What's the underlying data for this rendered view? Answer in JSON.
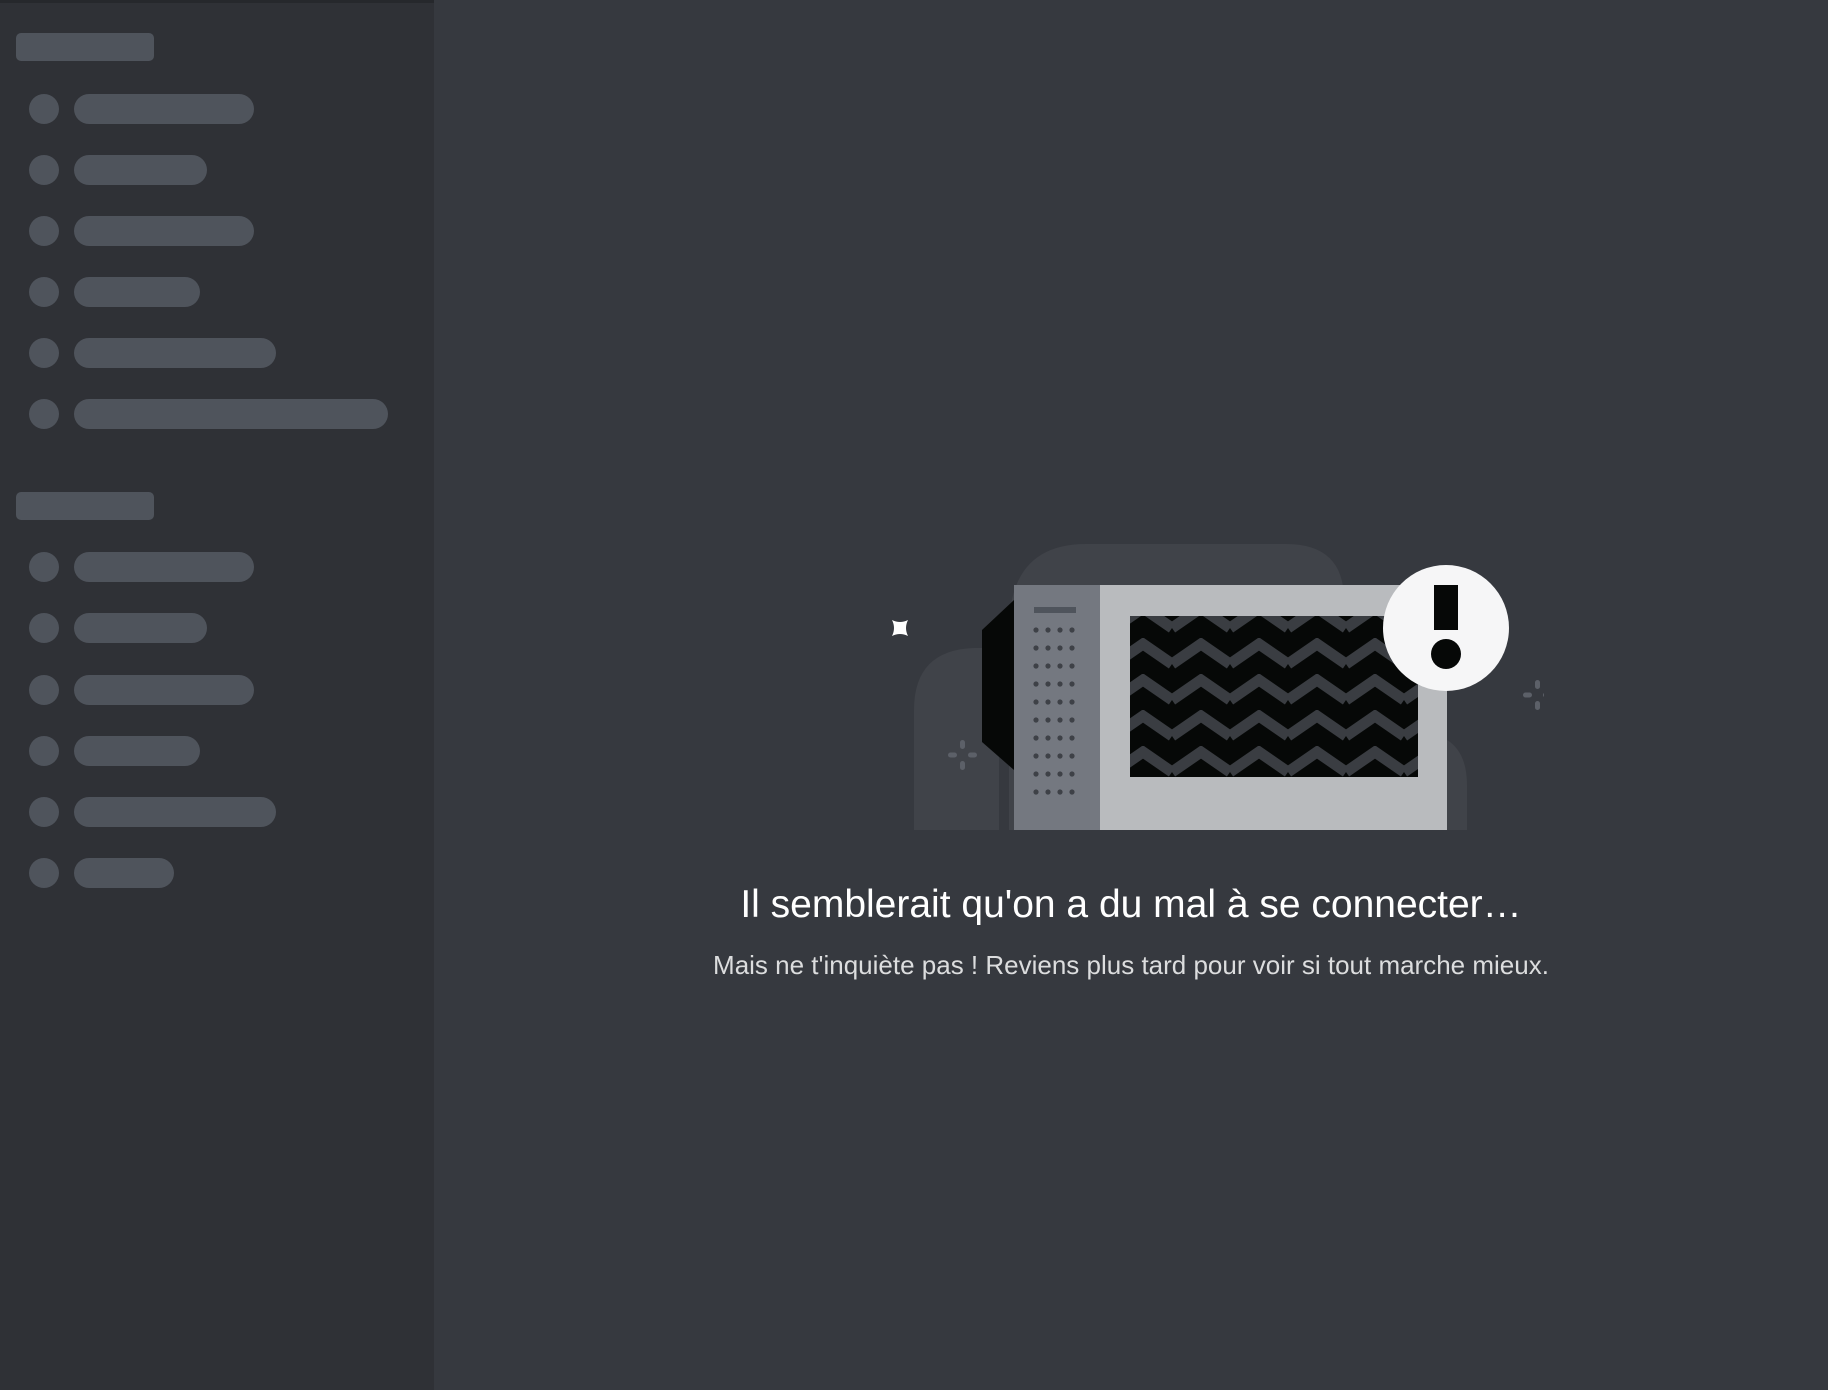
{
  "colors": {
    "main_background": "#36393f",
    "sidebar_background": "#2f3136",
    "skeleton": "#4f545c",
    "title_text": "#ffffff",
    "subtitle_text": "#dcddde"
  },
  "sidebar": {
    "state": "loading-skeleton",
    "groups": [
      {
        "placeholder_rows": 6
      },
      {
        "placeholder_rows": 6
      }
    ]
  },
  "illustration": {
    "icon": "broken-tv-warning-icon",
    "badge_icon": "exclamation-icon"
  },
  "message": {
    "title": "Il semblerait qu'on a du mal à se connecter…",
    "subtitle": "Mais ne t'inquiète pas ! Reviens plus tard pour voir si tout marche mieux."
  }
}
